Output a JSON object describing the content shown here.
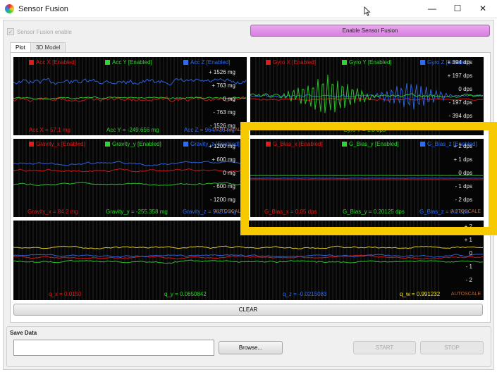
{
  "window": {
    "title": "Sensor Fusion",
    "minimize": "—",
    "maximize": "☐",
    "close": "✕"
  },
  "controls": {
    "checkbox_label": "Sensor Fusion enable",
    "checkbox_mark": "✓",
    "enable_button": "Enable Sensor Fusion"
  },
  "tabs": [
    {
      "label": "Plot"
    },
    {
      "label": "3D Model"
    }
  ],
  "colors": {
    "x_series": "#e21a1a",
    "y_series": "#2fd62f",
    "z_series": "#2f6bef",
    "w_series": "#f0e020",
    "highlight": "#f7c900",
    "enable_button": "#e08ce6"
  },
  "plots": {
    "acc": {
      "legend": [
        {
          "label": "Acc X [Enabled]"
        },
        {
          "label": "Acc Y [Enabled]"
        },
        {
          "label": "Acc Z [Enabled]"
        }
      ],
      "axis": [
        "+ 1526 mg",
        "+ 763 mg",
        "0 mg",
        "- 763 mg",
        "- 1526 mg"
      ],
      "readouts": [
        "Acc X = 57.1 mg",
        "Acc Y = -249.656 mg",
        "Acc Z = 964.736 mg"
      ],
      "autoscale": "AUTOSCALE"
    },
    "gyro": {
      "legend": [
        {
          "label": "Gyro X [Enabled]"
        },
        {
          "label": "Gyro Y [Enabled]"
        },
        {
          "label": "Gyro Z [Enabled]"
        }
      ],
      "axis": [
        "+ 394 dps",
        "+ 197 dps",
        "0 dps",
        "- 197 dps",
        "- 394 dps"
      ],
      "readouts": [
        "",
        "Gyro Y = 1.3 dps",
        ""
      ],
      "autoscale": ""
    },
    "gravity": {
      "legend": [
        {
          "label": "Gravity_x [Enabled]"
        },
        {
          "label": "Gravity_y [Enabled]"
        },
        {
          "label": "Gravity_z [Enabled]"
        }
      ],
      "axis": [
        "+ 1200 mg",
        "+ 600 mg",
        "0 mg",
        "- 600 mg",
        "- 1200 mg"
      ],
      "readouts": [
        "Gravity_x = 84.2 mg",
        "Gravity_y = -255.358 mg",
        "Gravity_z = 962.5 mg"
      ],
      "autoscale": "AUTOSCALE"
    },
    "gbias": {
      "legend": [
        {
          "label": "G_Bias_x [Enabled]"
        },
        {
          "label": "G_Bias_y [Enabled]"
        },
        {
          "label": "G_Bias_z [Enabled]"
        }
      ],
      "axis": [
        "+ 2 dps",
        "+ 1 dps",
        "0 dps",
        "- 1 dps",
        "- 2 dps"
      ],
      "readouts": [
        "G_Bias_x = 0.05 dps",
        "G_Bias_y = 0.20125 dps",
        "G_Bias_z = 0.1 dps"
      ],
      "autoscale": "AUTOSCALE"
    },
    "quat": {
      "axis": [
        "+ 2",
        "+ 1",
        "0",
        "- 1",
        "- 2"
      ],
      "readouts": [
        "q_x = 0.0150",
        "q_y = 0.0650842",
        "q_z = -0.0215083",
        "q_w = 0.991232"
      ],
      "autoscale": "AUTOSCALE"
    }
  },
  "buttons": {
    "clear": "CLEAR",
    "browse": "Browse...",
    "start": "START",
    "stop": "STOP"
  },
  "save": {
    "group_label": "Save Data",
    "path_value": ""
  }
}
